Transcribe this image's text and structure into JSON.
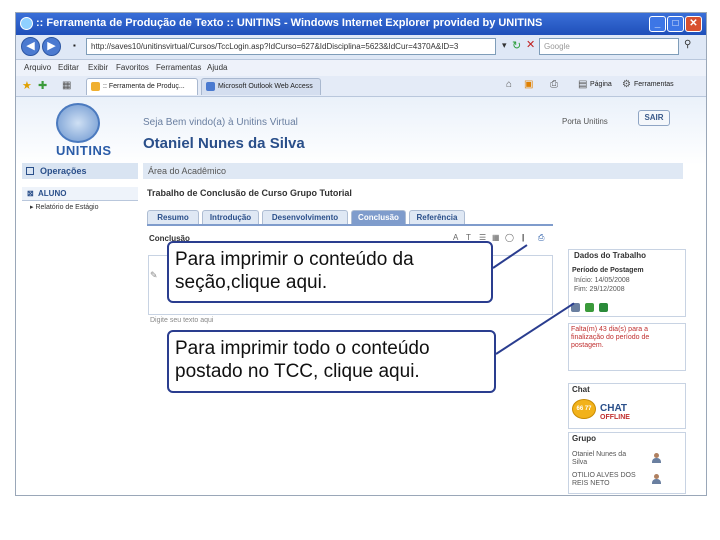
{
  "window": {
    "title": ":: Ferramenta de Produção de Texto :: UNITINS - Windows Internet Explorer provided by UNITINS"
  },
  "browser": {
    "address": "http://saves10/unitinsvirtual/Cursos/TccLogin.asp?IdCurso=627&IdDisciplina=5623&IdCur=4370A&ID=3",
    "search_placeholder": "Google",
    "menu": [
      "Arquivo",
      "Editar",
      "Exibir",
      "Favoritos",
      "Ferramentas",
      "Ajuda"
    ],
    "tabs": [
      {
        "label": ":: Ferramenta de Produç..."
      },
      {
        "label": "Microsoft Outlook Web Access"
      }
    ],
    "toolbar": {
      "page": "Página",
      "tools": "Ferramentas"
    }
  },
  "header": {
    "logo_text": "UNITINS",
    "welcome": "Seja Bem vindo(a) à Unitins Virtual",
    "user_name": "Otaniel Nunes da Silva",
    "portal_link": "Porta Unitins",
    "logout": "SAIR"
  },
  "sidebar": {
    "heading": "Operações",
    "role": "ALUNO",
    "item": "Relatório de Estágio"
  },
  "main": {
    "area": "Área do Acadêmico",
    "breadcrumb": "Trabalho de Conclusão de Curso   Grupo Tutorial",
    "tabs": [
      "Resumo",
      "Introdução",
      "Desenvolvimento",
      "Conclusão",
      "Referência"
    ],
    "active_tab": "Conclusão",
    "section_title": "Conclusão",
    "placeholder": "Digite seu texto aqui"
  },
  "right_panel": {
    "dados_title": "Dados do Trabalho",
    "periodo_title": "Período de Postagem",
    "inicio": "Início: 14/05/2008",
    "fim": "Fim: 29/12/2008",
    "warning": "Falta(m) 43 dia(s) para a finalização do período de postagem.",
    "chat_title": "Chat",
    "chat_label": "CHAT",
    "chat_status": "OFFLINE",
    "grupo_title": "Grupo",
    "members": [
      "Otaniel Nunes da Silva",
      "OTILIO ALVES DOS REIS NETO"
    ]
  },
  "callouts": {
    "print_section": "Para imprimir o conteúdo da seção,clique aqui.",
    "print_all": "Para imprimir todo o conteúdo postado no TCC, clique aqui."
  }
}
